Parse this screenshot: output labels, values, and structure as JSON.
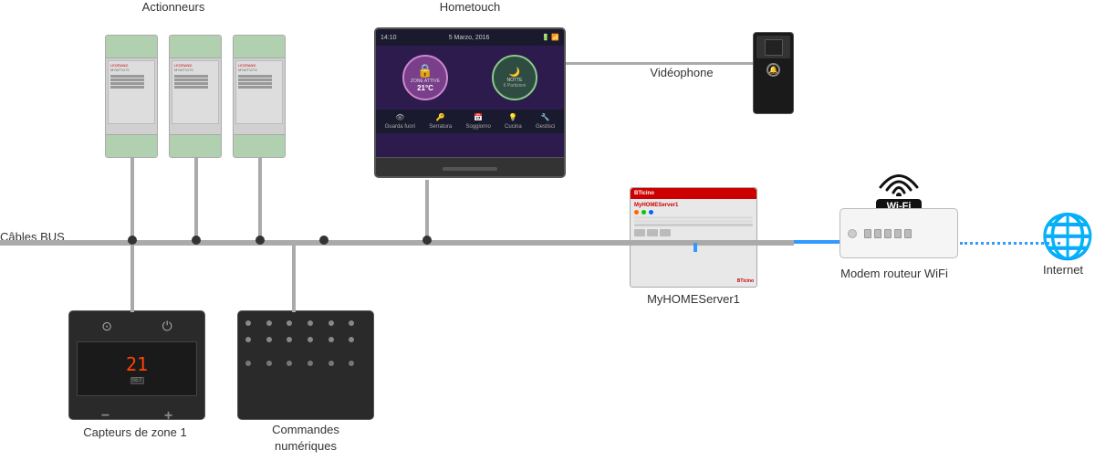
{
  "labels": {
    "actionneurs": "Actionneurs",
    "hometouch": "Hometouch",
    "videophone": "Vidéophone",
    "cables_bus": "Câbles BUS",
    "myhomeserver": "MyHOMEServer1",
    "modem_routeur": "Modem routeur WiFi",
    "internet": "Internet",
    "capteurs_zone": "Capteurs de zone 1",
    "commandes_numeriques": "Commandes\nnumériques",
    "zone_active": "ZONE ATTIVE",
    "notte": "NOTTE\n6 Partizioni",
    "temp": "21°C",
    "wifi_label": "Wi-Fi"
  },
  "colors": {
    "bus": "#aaaaaa",
    "blue_cable": "#3399ff",
    "dark_device": "#2a2a2a",
    "actuator_bg": "#d0d0d0",
    "server_top": "#cc0000",
    "screen_bg": "#2d1b4e"
  }
}
